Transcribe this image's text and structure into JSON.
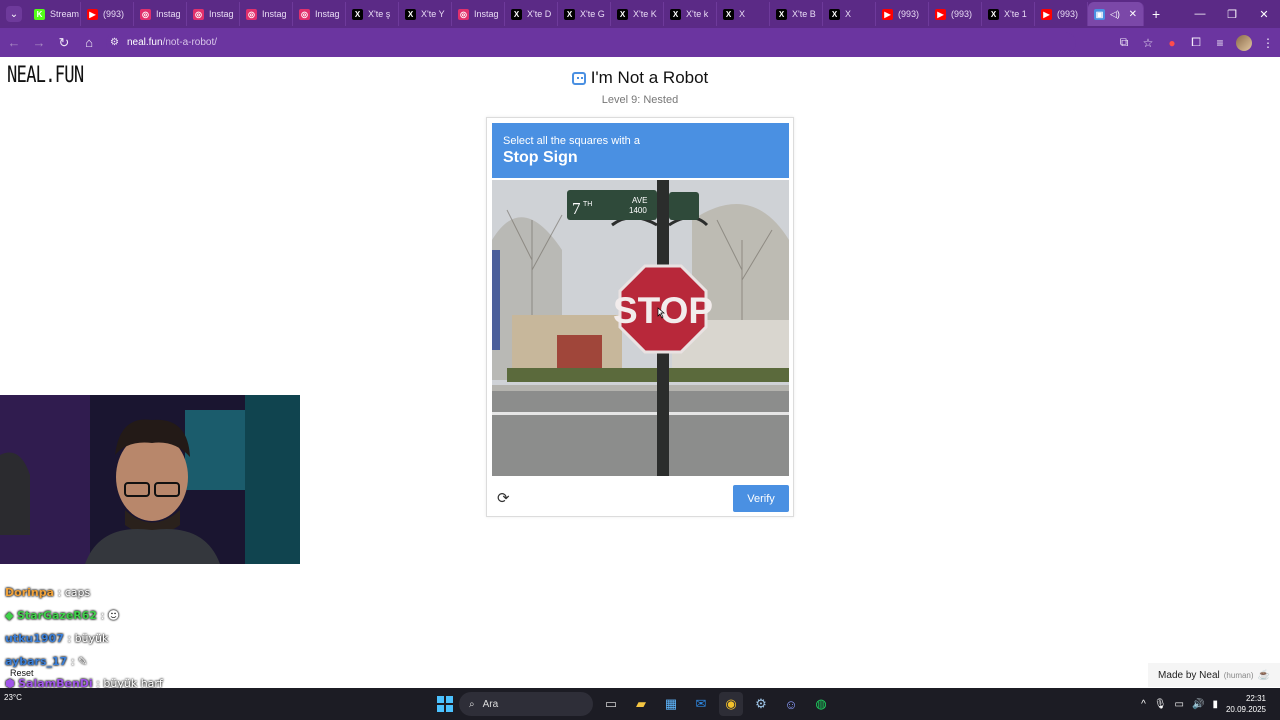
{
  "browser": {
    "tabs": [
      {
        "label": "Stream",
        "fav": "K",
        "color": "#53fc18"
      },
      {
        "label": "(993)",
        "fav": "▶",
        "color": "#ff0000"
      },
      {
        "label": "Instag",
        "fav": "◎",
        "color": "#e1306c"
      },
      {
        "label": "Instag",
        "fav": "◎",
        "color": "#e1306c"
      },
      {
        "label": "Instag",
        "fav": "◎",
        "color": "#e1306c"
      },
      {
        "label": "Instag",
        "fav": "◎",
        "color": "#e1306c"
      },
      {
        "label": "X'te ş",
        "fav": "X",
        "color": "#000000"
      },
      {
        "label": "X'te Y",
        "fav": "X",
        "color": "#000000"
      },
      {
        "label": "Instag",
        "fav": "◎",
        "color": "#e1306c"
      },
      {
        "label": "X'te D",
        "fav": "X",
        "color": "#000000"
      },
      {
        "label": "X'te G",
        "fav": "X",
        "color": "#000000"
      },
      {
        "label": "X'te K",
        "fav": "X",
        "color": "#000000"
      },
      {
        "label": "X'te k",
        "fav": "X",
        "color": "#000000"
      },
      {
        "label": "X",
        "fav": "X",
        "color": "#000000"
      },
      {
        "label": "X'te B",
        "fav": "X",
        "color": "#000000"
      },
      {
        "label": "X",
        "fav": "X",
        "color": "#000000"
      },
      {
        "label": "(993)",
        "fav": "▶",
        "color": "#ff0000"
      },
      {
        "label": "(993)",
        "fav": "▶",
        "color": "#ff0000"
      },
      {
        "label": "X'te 1",
        "fav": "X",
        "color": "#000000"
      },
      {
        "label": "(993)",
        "fav": "▶",
        "color": "#ff0000"
      }
    ],
    "active_tab_close": "✕",
    "new_tab": "+",
    "url_host": "neal.fun",
    "url_path": "/not-a-robot/",
    "theme_color": "#5b2a86"
  },
  "page": {
    "logo": "NEAL.FUN",
    "title": "I'm Not a Robot",
    "subtitle": "Level 9: Nested",
    "accent_color": "#4a90e2"
  },
  "captcha": {
    "instruction": "Select all the squares with a",
    "target": "Stop Sign",
    "image_text": {
      "street_number": "7",
      "street_suffix": "TH",
      "street_type": "AVE",
      "block": "1400",
      "sign_word": "STOP"
    },
    "reload_icon": "⟳",
    "verify_label": "Verify"
  },
  "chat": [
    {
      "user": "Dorinpa",
      "message": "caps",
      "color": "#f0a23a"
    },
    {
      "user": "StarGazeR62",
      "message": "",
      "color": "#3fd14a"
    },
    {
      "user": "utku1907",
      "message": "büyük",
      "color": "#3a7fd8"
    },
    {
      "user": "aybars_17",
      "message": "",
      "color": "#3a7fd8"
    },
    {
      "user": "SalamBenDi",
      "message": "büyük harf",
      "color": "#a055e8"
    }
  ],
  "overlay": {
    "reset_label": "Reset",
    "made_by": "Made by Neal",
    "human_tag": "(human)"
  },
  "taskbar": {
    "temperature": "23°C",
    "search_placeholder": "Ara",
    "time": "22:31",
    "date": "20.09.2025"
  }
}
